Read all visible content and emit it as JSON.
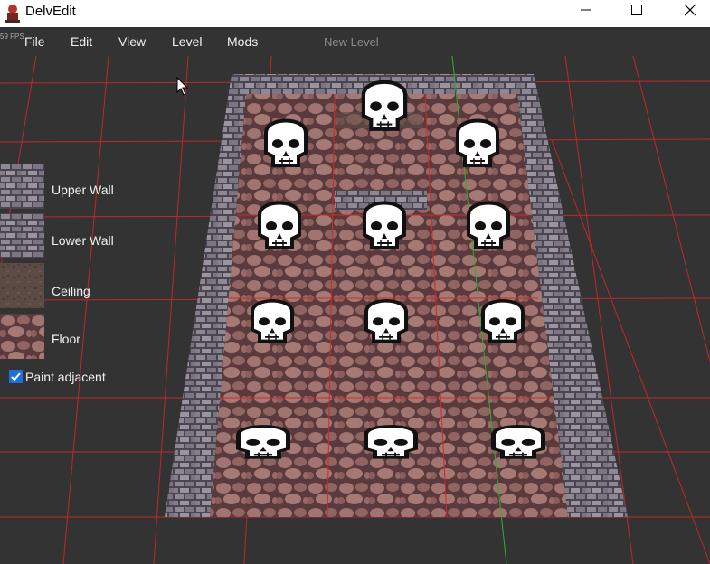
{
  "window": {
    "title": "DelvEdit",
    "controls": [
      "minimize-icon",
      "maximize-icon",
      "close-icon"
    ]
  },
  "hud": {
    "fps": "59 FPS",
    "level_name": "New Level"
  },
  "menu": [
    {
      "label": "File"
    },
    {
      "label": "Edit"
    },
    {
      "label": "View"
    },
    {
      "label": "Level"
    },
    {
      "label": "Mods"
    }
  ],
  "textures": [
    {
      "label": "Upper Wall",
      "icon": "stone-brick-texture"
    },
    {
      "label": "Lower Wall",
      "icon": "stone-brick-texture"
    },
    {
      "label": "Ceiling",
      "icon": "dirt-texture"
    },
    {
      "label": "Floor",
      "icon": "cobblestone-texture"
    }
  ],
  "paint_adjacent": {
    "label": "Paint adjacent",
    "checked": true
  },
  "scene": {
    "skull_markers": 12,
    "colors": {
      "grid": "#cc1f1f",
      "floor": "#8a5c58",
      "wall": "#6b6670",
      "background": "#333333",
      "accent_axis": "#2fae2f"
    }
  }
}
